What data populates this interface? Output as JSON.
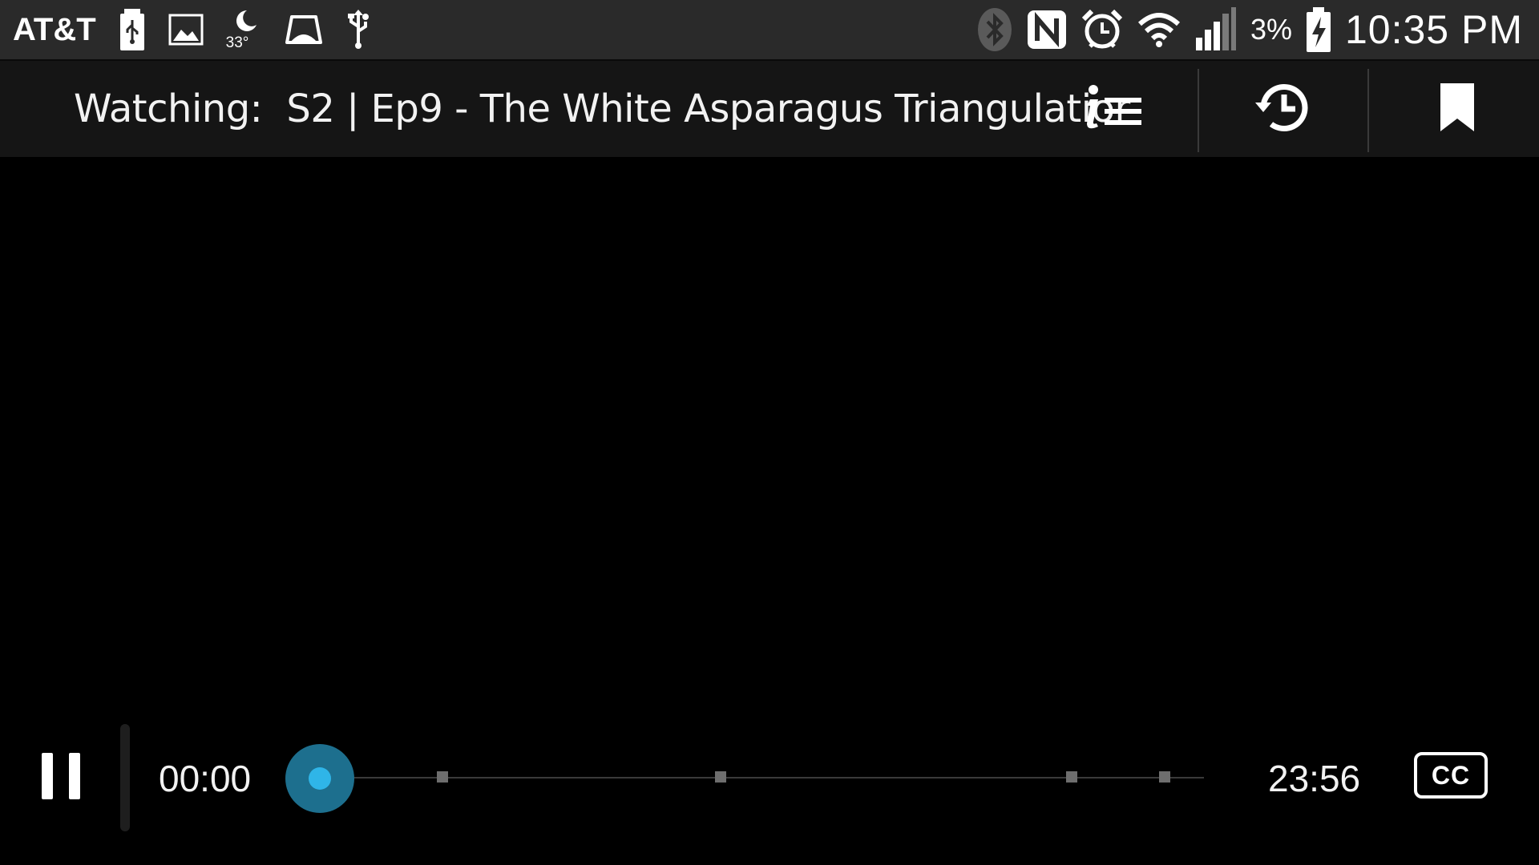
{
  "status_bar": {
    "carrier": "AT&T",
    "weather_temp": "33°",
    "battery_percent": "3%",
    "time": "10:35 PM",
    "left_icons": [
      "usb-storage-icon",
      "gallery-icon",
      "weather-moon-icon",
      "cloud-drive-icon",
      "usb-icon"
    ],
    "right_icons": [
      "bluetooth-icon",
      "nfc-icon",
      "alarm-icon",
      "wifi-icon",
      "signal-icon",
      "battery-charging-icon"
    ]
  },
  "title_bar": {
    "label": "Watching:",
    "episode_title": "S2 | Ep9 - The White Asparagus Triangulatior",
    "actions": [
      "info-list-icon",
      "history-icon",
      "bookmark-icon"
    ]
  },
  "player": {
    "elapsed": "00:00",
    "total": "23:56",
    "progress": 0,
    "cc_label": "CC",
    "accent_color": "#2fb5e8",
    "thumb_color": "#1d6f8e"
  }
}
